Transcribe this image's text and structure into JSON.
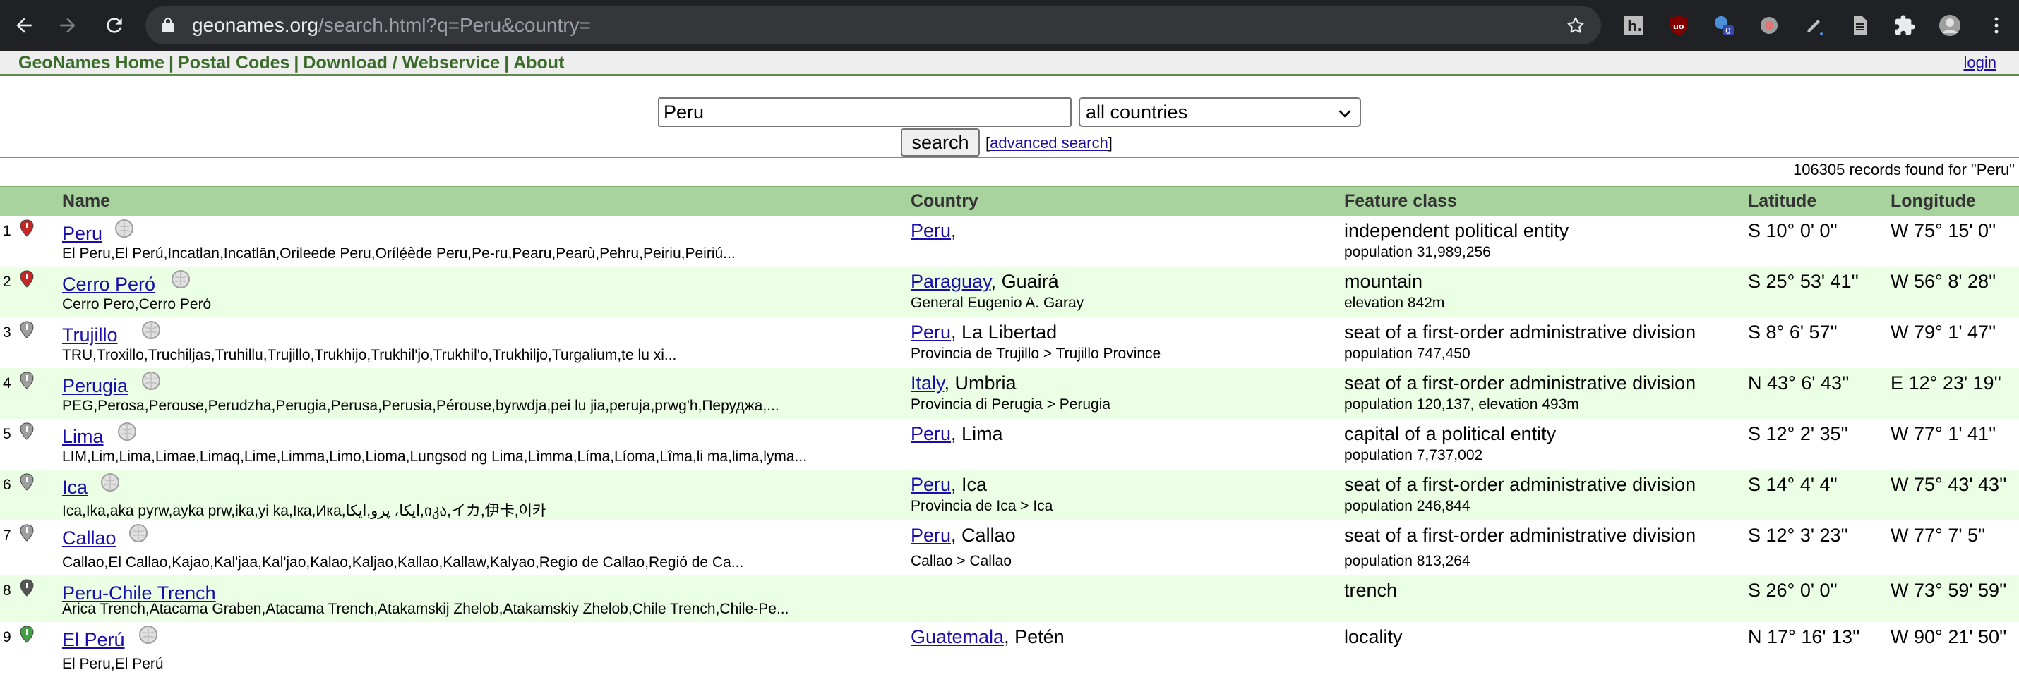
{
  "browser": {
    "url_host": "geonames.org",
    "url_path": "/search.html?q=Peru&country=",
    "icons": [
      "back-icon",
      "forward-icon",
      "reload-icon",
      "lock-icon",
      "star-icon",
      "hypothesis-extension-icon",
      "ublock-extension-icon",
      "extension-badge-icon",
      "extension-icon",
      "pen-extension-icon",
      "document-extension-icon",
      "puzzle-extensions-icon",
      "profile-avatar",
      "more-menu-icon"
    ],
    "extension_badge_count": "0",
    "ublock_label": "uo",
    "hypothesis_label": "h."
  },
  "site_nav": {
    "items": [
      "GeoNames Home",
      "Postal Codes",
      "Download / Webservice",
      "About"
    ],
    "separator": "|",
    "login": "login"
  },
  "search": {
    "query": "Peru",
    "country_selected": "all countries",
    "button": "search",
    "advanced_prefix": "[",
    "advanced_link": "advanced search",
    "advanced_suffix": "]"
  },
  "results_summary": "106305 records found for \"Peru\"",
  "table": {
    "headers": {
      "name": "Name",
      "country": "Country",
      "feature": "Feature class",
      "latitude": "Latitude",
      "longitude": "Longitude"
    },
    "rows": [
      {
        "num": "1",
        "marker_color": "#c62828",
        "name": "Peru",
        "alternates": "El Peru,El Perú,Incatlan,Incatlān,Orileede Peru,Orílẹ́ède Peru,Pe-ru,Pearu,Pearù,Pehru,Peiriu,Peiriú...",
        "country_link": "Peru",
        "country_rest": ",",
        "admin": "",
        "feature": "independent political entity",
        "stat": "population 31,989,256",
        "lat": "S 10° 0' 0''",
        "lng": "W 75° 15' 0''"
      },
      {
        "num": "2",
        "marker_color": "#c62828",
        "name": "Cerro Peró",
        "alternates": "Cerro Pero,Cerro Peró",
        "country_link": "Paraguay",
        "country_rest": ", Guairá",
        "admin": "General Eugenio A. Garay",
        "feature": "mountain",
        "stat": "elevation 842m",
        "lat": "S 25° 53' 41''",
        "lng": "W 56° 8' 28''"
      },
      {
        "num": "3",
        "marker_color": "#9e9e9e",
        "name": "Trujillo",
        "alternates": "TRU,Troxillo,Truchiljas,Truhillu,Trujillo,Trukhijo,Trukhil'jo,Trukhil'o,Trukhiljo,Turgalium,te lu xi...",
        "country_link": "Peru",
        "country_rest": ", La Libertad",
        "admin": "Provincia de Trujillo > Trujillo Province",
        "feature": "seat of a first-order administrative division",
        "stat": "population 747,450",
        "lat": "S 8° 6' 57''",
        "lng": "W 79° 1' 47''"
      },
      {
        "num": "4",
        "marker_color": "#9e9e9e",
        "name": "Perugia",
        "alternates": "PEG,Perosa,Perouse,Perudzha,Perugia,Perusa,Perusia,Pérouse,byrwdja,pei lu jia,peruja,prwg'h,Перуджа,...",
        "country_link": "Italy",
        "country_rest": ", Umbria",
        "admin": "Provincia di Perugia > Perugia",
        "feature": "seat of a first-order administrative division",
        "stat": "population 120,137, elevation 493m",
        "lat": "N 43° 6' 43''",
        "lng": "E 12° 23' 19''"
      },
      {
        "num": "5",
        "marker_color": "#9e9e9e",
        "name": "Lima",
        "alternates": "LIM,Lim,Lima,Limae,Limaq,Lime,Limma,Limo,Lioma,Lungsod ng Lima,Lìmma,Líma,Líoma,Lîma,li ma,lima,lyma...",
        "country_link": "Peru",
        "country_rest": ", Lima",
        "admin": "",
        "feature": "capital of a political entity",
        "stat": "population 7,737,002",
        "lat": "S 12° 2' 35''",
        "lng": "W 77° 1' 41''"
      },
      {
        "num": "6",
        "marker_color": "#9e9e9e",
        "name": "Ica",
        "alternates": "Ica,Ika,aka pyrw,ayka prw,ika,yi ka,Iкa,Ика,ایکا، پرو,ایکا,იკა,イカ,伊卡,이카",
        "country_link": "Peru",
        "country_rest": ", Ica",
        "admin": "Provincia de Ica > Ica",
        "feature": "seat of a first-order administrative division",
        "stat": "population 246,844",
        "lat": "S 14° 4' 4''",
        "lng": "W 75° 43' 43''"
      },
      {
        "num": "7",
        "marker_color": "#9e9e9e",
        "name": "Callao",
        "alternates": "Callao,El Callao,Kajao,Kal'jaa,Kal'jao,Kalao,Kaljao,Kallao,Kallaw,Kalyao,Regio de Callao,Regió de Ca...",
        "country_link": "Peru",
        "country_rest": ", Callao",
        "admin": "Callao > Callao",
        "feature": "seat of a first-order administrative division",
        "stat": "population 813,264",
        "lat": "S 12° 3' 23''",
        "lng": "W 77° 7' 5''"
      },
      {
        "num": "8",
        "marker_color": "#555555",
        "name": "Peru-Chile Trench",
        "alternates": "Arica Trench,Atacama Graben,Atacama Trench,Atakamskij Zhelob,Atakamskiy Zhelob,Chile Trench,Chile-Pe...",
        "country_link": "",
        "country_rest": "",
        "admin": "",
        "feature": "trench",
        "stat": "",
        "lat": "S 26° 0' 0''",
        "lng": "W 73° 59' 59''"
      },
      {
        "num": "9",
        "marker_color": "#43a047",
        "name": "El Perú",
        "alternates": "El Peru,El Perú",
        "country_link": "Guatemala",
        "country_rest": ", Petén",
        "admin": "",
        "feature": "locality",
        "stat": "",
        "lat": "N 17° 16' 13''",
        "lng": "W 90° 21' 50''"
      }
    ]
  }
}
